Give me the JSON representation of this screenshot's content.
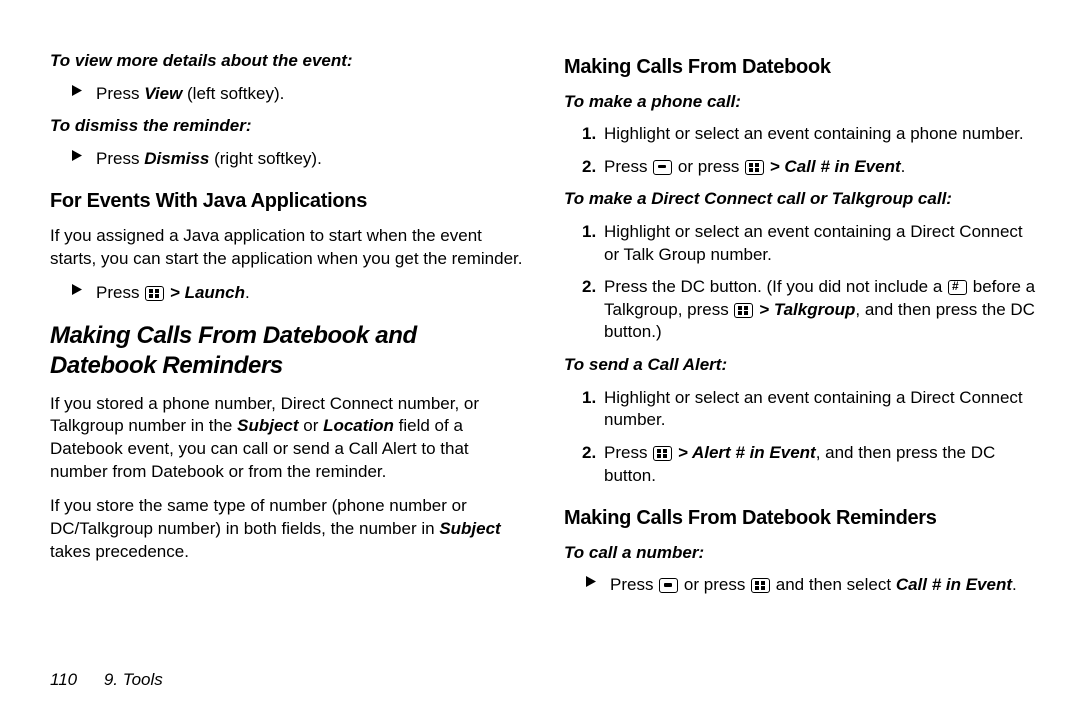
{
  "left": {
    "lead1": "To view more details about the event:",
    "bullet1_a": "Press ",
    "bullet1_b": "View",
    "bullet1_c": " (left softkey).",
    "lead2": "To dismiss the reminder:",
    "bullet2_a": "Press ",
    "bullet2_b": "Dismiss",
    "bullet2_c": " (right softkey).",
    "h3": "For Events With Java Applications",
    "para1": "If you assigned a Java application to start when the event starts, you can start the application when you get the reminder.",
    "bullet3_a": "Press ",
    "bullet3_gt": " > ",
    "bullet3_b": "Launch",
    "bullet3_c": ".",
    "h2": "Making Calls From Datebook and Datebook Reminders",
    "para2_a": "If you stored a phone number, Direct Connect number, or Talkgroup number in the ",
    "para2_b": "Subject",
    "para2_c": " or ",
    "para2_d": "Location",
    "para2_e": " field of a Datebook event, you can call or send a Call Alert to that number from Datebook or from the reminder.",
    "para3_a": "If you store the same type of number (phone number or DC/Talkgroup number) in both fields, the number in ",
    "para3_b": "Subject",
    "para3_c": " takes precedence."
  },
  "right": {
    "h3a": "Making Calls From Datebook",
    "lead1": "To make a phone call:",
    "oi1": "Highlight or select an event containing a phone number.",
    "oi2_a": "Press ",
    "oi2_b": " or press ",
    "oi2_gt": " > ",
    "oi2_c": "Call # in Event",
    "oi2_d": ".",
    "lead2": "To make a Direct Connect call or Talkgroup call:",
    "oi3": "Highlight or select an event containing a Direct Connect or Talk Group number.",
    "oi4_a": "Press the DC button. (If you did not include a ",
    "oi4_b": " before a Talkgroup, press ",
    "oi4_gt": " > ",
    "oi4_c": "Talkgroup",
    "oi4_d": ", and then press the DC button.)",
    "lead3": "To send a Call Alert:",
    "oi5": "Highlight or select an event containing a Direct Connect number.",
    "oi6_a": "Press ",
    "oi6_gt": " > ",
    "oi6_b": "Alert # in Event",
    "oi6_c": ", and then press the DC button.",
    "h3b": "Making Calls From Datebook Reminders",
    "lead4": "To call a number:",
    "bullet_a": "Press ",
    "bullet_b": " or press ",
    "bullet_c": " and then select ",
    "bullet_d": "Call # in Event",
    "bullet_e": "."
  },
  "footer": {
    "page": "110",
    "chapter": "9. Tools"
  }
}
